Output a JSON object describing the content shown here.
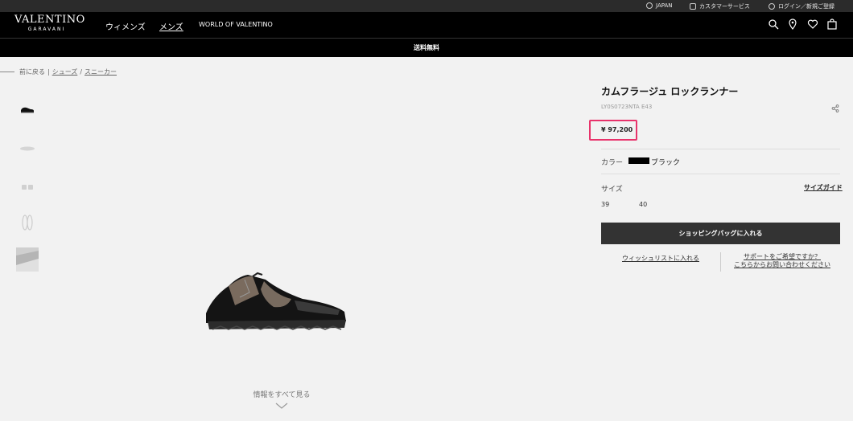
{
  "utility": {
    "country": "JAPAN",
    "customer_service": "カスタマーサービス",
    "login": "ログイン／新規ご登録"
  },
  "header": {
    "logo_main": "VALENTINO",
    "logo_sub": "GARAVANI",
    "nav": [
      "ウィメンズ",
      "メンズ",
      "WORLD OF VALENTINO"
    ],
    "icons": [
      "search-icon",
      "location-icon",
      "heart-icon",
      "bag-icon"
    ]
  },
  "promo": "送料無料",
  "breadcrumb": {
    "back": "前に戻る",
    "sep1": "|",
    "item1": "シューズ",
    "sep2": "/",
    "item2": "スニーカー"
  },
  "gallery": {
    "see_all": "情報をすべて見る"
  },
  "product": {
    "title": "カムフラージュ ロックランナー",
    "sku": "LY0S0723NTA E43",
    "price": "¥ 97,200",
    "color_label": "カラー",
    "color_value": "ブラック",
    "size_label": "サイズ",
    "size_guide": "サイズガイド",
    "sizes": [
      "39",
      "40"
    ],
    "add_to_cart": "ショッピングバッグに入れる",
    "wishlist": "ウィッシュリストに入れる",
    "support_line1": "サポートをご希望ですか？",
    "support_line2": "こちらからお問い合わせください"
  },
  "colors": {
    "highlight": "#e8336b",
    "cart_button": "#333333",
    "nav_bg": "#000000"
  }
}
